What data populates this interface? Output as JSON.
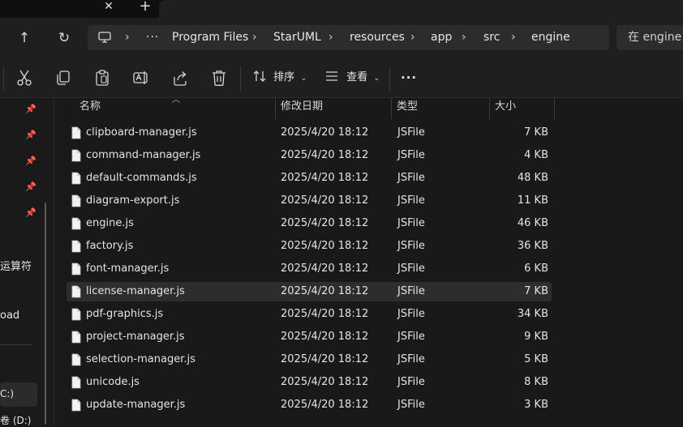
{
  "window": {
    "close_tab_glyph": "✕",
    "new_tab_glyph": "+"
  },
  "nav": {
    "up_glyph": "↑",
    "refresh_glyph": "↻",
    "more_glyph": "···",
    "breadcrumb": [
      "Program Files",
      "StarUML",
      "resources",
      "app",
      "src",
      "engine"
    ],
    "search_placeholder": "在 engine 中"
  },
  "toolbar": {
    "sort_label": "排序",
    "view_label": "查看",
    "more_glyph": "···"
  },
  "sidebar": {
    "partial_items": [
      "运算符",
      "oad",
      "C:)",
      "卷 (D:)"
    ]
  },
  "columns": {
    "name": "名称",
    "modified": "修改日期",
    "type": "类型",
    "size": "大小"
  },
  "files": [
    {
      "name": "clipboard-manager.js",
      "modified": "2025/4/20 18:12",
      "type": "JSFile",
      "size": "7 KB"
    },
    {
      "name": "command-manager.js",
      "modified": "2025/4/20 18:12",
      "type": "JSFile",
      "size": "4 KB"
    },
    {
      "name": "default-commands.js",
      "modified": "2025/4/20 18:12",
      "type": "JSFile",
      "size": "48 KB"
    },
    {
      "name": "diagram-export.js",
      "modified": "2025/4/20 18:12",
      "type": "JSFile",
      "size": "11 KB"
    },
    {
      "name": "engine.js",
      "modified": "2025/4/20 18:12",
      "type": "JSFile",
      "size": "46 KB"
    },
    {
      "name": "factory.js",
      "modified": "2025/4/20 18:12",
      "type": "JSFile",
      "size": "36 KB"
    },
    {
      "name": "font-manager.js",
      "modified": "2025/4/20 18:12",
      "type": "JSFile",
      "size": "6 KB"
    },
    {
      "name": "license-manager.js",
      "modified": "2025/4/20 18:12",
      "type": "JSFile",
      "size": "7 KB",
      "selected": true
    },
    {
      "name": "pdf-graphics.js",
      "modified": "2025/4/20 18:12",
      "type": "JSFile",
      "size": "34 KB"
    },
    {
      "name": "project-manager.js",
      "modified": "2025/4/20 18:12",
      "type": "JSFile",
      "size": "9 KB"
    },
    {
      "name": "selection-manager.js",
      "modified": "2025/4/20 18:12",
      "type": "JSFile",
      "size": "5 KB"
    },
    {
      "name": "unicode.js",
      "modified": "2025/4/20 18:12",
      "type": "JSFile",
      "size": "8 KB"
    },
    {
      "name": "update-manager.js",
      "modified": "2025/4/20 18:12",
      "type": "JSFile",
      "size": "3 KB"
    }
  ],
  "colors": {
    "background": "#191919",
    "chrome": "#1f1f1f",
    "selected_row": "#2d2d2d",
    "accent_text": "#e6e6e6"
  }
}
